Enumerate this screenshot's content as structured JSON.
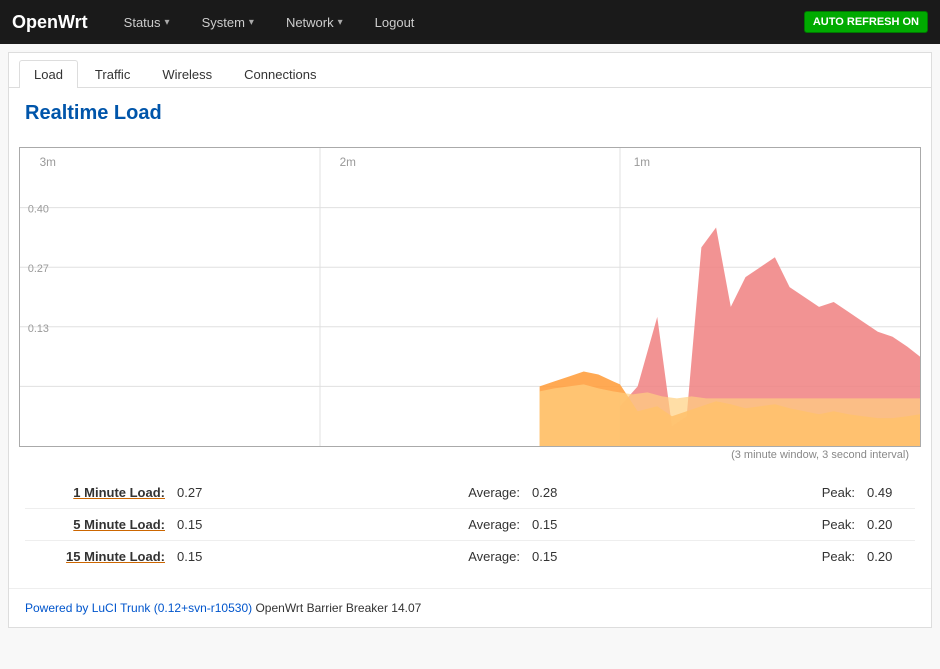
{
  "brand": "OpenWrt",
  "nav": {
    "items": [
      {
        "label": "Status",
        "has_dropdown": true
      },
      {
        "label": "System",
        "has_dropdown": true
      },
      {
        "label": "Network",
        "has_dropdown": true
      },
      {
        "label": "Logout",
        "has_dropdown": false
      }
    ],
    "auto_refresh": "AUTO REFRESH ON"
  },
  "tabs": [
    {
      "label": "Load",
      "active": true
    },
    {
      "label": "Traffic",
      "active": false
    },
    {
      "label": "Wireless",
      "active": false
    },
    {
      "label": "Connections",
      "active": false
    }
  ],
  "page_title": "Realtime Load",
  "chart": {
    "x_labels": [
      "3m",
      "2m",
      "1m"
    ],
    "y_labels": [
      "0.40",
      "0.27",
      "0.13"
    ],
    "window_label": "(3 minute window, 3 second interval)"
  },
  "stats": [
    {
      "label": "1 Minute Load:",
      "value": "0.27",
      "avg_label": "Average:",
      "avg_value": "0.28",
      "peak_label": "Peak:",
      "peak_value": "0.49"
    },
    {
      "label": "5 Minute Load:",
      "value": "0.15",
      "avg_label": "Average:",
      "avg_value": "0.15",
      "peak_label": "Peak:",
      "peak_value": "0.20"
    },
    {
      "label": "15 Minute Load:",
      "value": "0.15",
      "avg_label": "Average:",
      "avg_value": "0.15",
      "peak_label": "Peak:",
      "peak_value": "0.20"
    }
  ],
  "footer": {
    "link_text": "Powered by LuCI Trunk (0.12+svn-r10530)",
    "suffix": " OpenWrt Barrier Breaker 14.07"
  }
}
